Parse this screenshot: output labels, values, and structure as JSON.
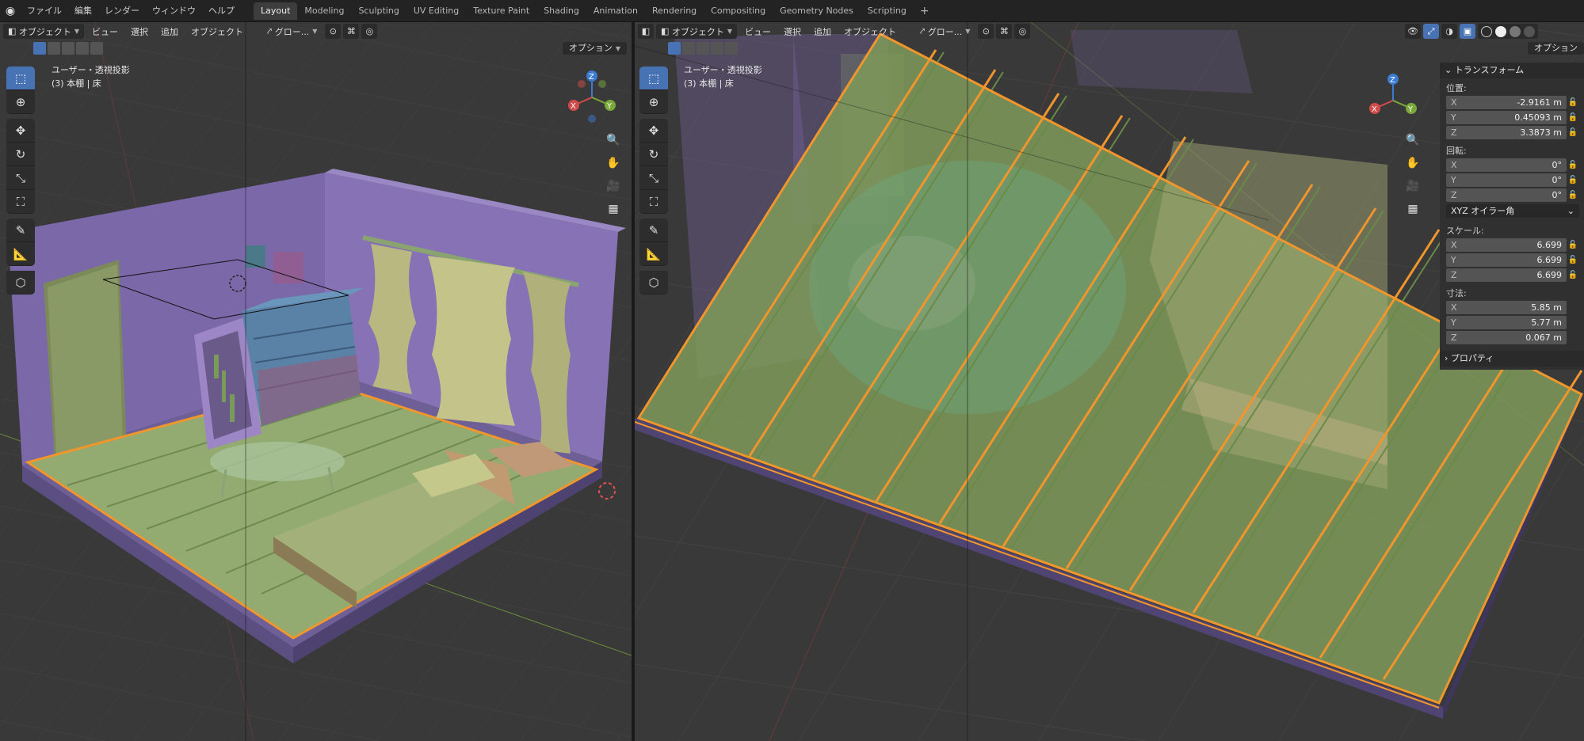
{
  "topbar": {
    "logo": "blender-logo-icon",
    "menus": [
      "ファイル",
      "編集",
      "レンダー",
      "ウィンドウ",
      "ヘルプ"
    ],
    "workspaces": [
      "Layout",
      "Modeling",
      "Sculpting",
      "UV Editing",
      "Texture Paint",
      "Shading",
      "Animation",
      "Rendering",
      "Compositing",
      "Geometry Nodes",
      "Scripting"
    ],
    "active_workspace": "Layout",
    "add_tab": "+"
  },
  "left_view": {
    "mode": "オブジェクト",
    "menus": [
      "ビュー",
      "選択",
      "追加",
      "オブジェクト"
    ],
    "transform_orientation": "グロー...",
    "options": "オプション",
    "view_name": "ユーザー・透視投影",
    "collection": "(3) 本棚 | 床"
  },
  "right_view": {
    "mode": "オブジェクト",
    "menus": [
      "ビュー",
      "選択",
      "追加",
      "オブジェクト"
    ],
    "transform_orientation": "グロー...",
    "options": "オプション",
    "view_name": "ユーザー・透視投影",
    "collection": "(3) 本棚 | 床"
  },
  "gizmo": {
    "x": "X",
    "y": "Y",
    "z": "Z"
  },
  "tools": [
    "select-box-icon",
    "cursor-icon",
    "move-icon",
    "rotate-icon",
    "scale-icon",
    "transform-icon",
    "annotate-icon",
    "measure-icon",
    "add-cube-icon"
  ],
  "nav": [
    "zoom-icon",
    "pan-hand-icon",
    "camera-icon",
    "ortho-grid-icon"
  ],
  "npanel": {
    "title": "トランスフォーム",
    "location_label": "位置:",
    "location": {
      "x": "-2.9161 m",
      "y": "0.45093 m",
      "z": "3.3873 m"
    },
    "rotation_label": "回転:",
    "rotation": {
      "x": "0°",
      "y": "0°",
      "z": "0°"
    },
    "rotation_mode": "XYZ オイラー角",
    "scale_label": "スケール:",
    "scale": {
      "x": "6.699",
      "y": "6.699",
      "z": "6.699"
    },
    "dimensions_label": "寸法:",
    "dimensions": {
      "x": "5.85 m",
      "y": "5.77 m",
      "z": "0.067 m"
    },
    "properties": "プロパティ"
  },
  "colors": {
    "accent": "#4772b3",
    "selection": "#f0962c",
    "wall": "#7a68a8",
    "floor": "#8aa468",
    "viewport_bg": "#393939"
  }
}
